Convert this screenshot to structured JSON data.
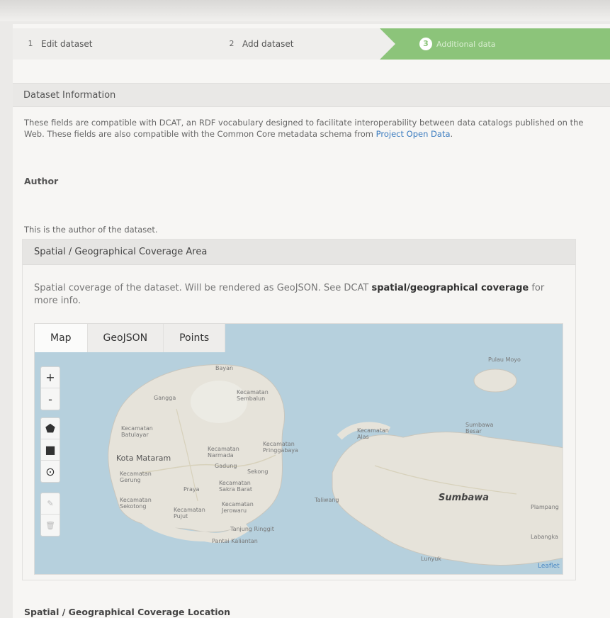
{
  "stages": [
    {
      "num": "1",
      "label": "Edit dataset"
    },
    {
      "num": "2",
      "label": "Add dataset"
    },
    {
      "num": "3",
      "label": "Additional data"
    }
  ],
  "section": {
    "title": "Dataset Information",
    "intro_before": "These fields are compatible with DCAT, an RDF vocabulary designed to facilitate interoperability between data catalogs published on the Web. These fields are also compatible with the Common Core metadata schema from ",
    "intro_link": "Project Open Data",
    "intro_after": "."
  },
  "author": {
    "label": "Author",
    "help": "This is the author of the dataset."
  },
  "spatial_area": {
    "title": "Spatial / Geographical Coverage Area",
    "desc_before": "Spatial coverage of the dataset. Will be rendered as GeoJSON. See DCAT ",
    "desc_link": "spatial/geographical coverage",
    "desc_after": " for more info.",
    "tabs": [
      "Map",
      "GeoJSON",
      "Points"
    ],
    "zoom_in": "+",
    "zoom_out": "-",
    "attribution": "Leaflet",
    "map_labels": {
      "bayan": "Bayan",
      "gangga": "Gangga",
      "sembalun": "Kecamatan Sembalun",
      "batulayar": "Kecamatan Batulayar",
      "mataram": "Kota Mataram",
      "narmada": "Kecamatan Narmada",
      "gerung": "Kecamatan Gerung",
      "sekotong": "Kecamatan Sekotong",
      "praya": "Praya",
      "pringgabaya": "Kecamatan Pringgabaya",
      "gadung": "Gadung",
      "sakra": "Kecamatan Sakra Barat",
      "jerowaru": "Kecamatan Jerowaru",
      "pujut": "Kecamatan Pujut",
      "sekong": "Sekong",
      "alas": "Kecamatan Alas",
      "taliwang": "Taliwang",
      "sumbawa": "Sumbawa",
      "sumbawa_besar": "Sumbawa Besar",
      "pulau_moyo": "Pulau Moyo",
      "tanjung_ringgit": "Tanjung Ringgit",
      "pantai": "Pantai Kaliantan",
      "lunyuk": "Lunyuk",
      "plampang": "Plampang",
      "labangka": "Labangka"
    }
  },
  "next_label": "Spatial / Geographical Coverage Location"
}
